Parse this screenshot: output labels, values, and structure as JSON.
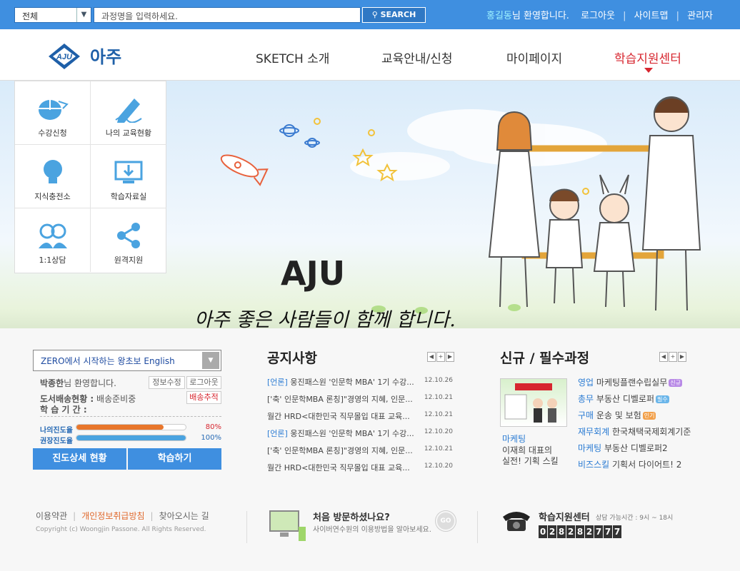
{
  "topbar": {
    "select_value": "전체",
    "search_placeholder": "과정명을 입력하세요.",
    "search_button": "SEARCH",
    "user_name": "홍길동",
    "welcome": "님 환영합니다.",
    "logout": "로그아웃",
    "sitemap": "사이트맵",
    "admin": "관리자"
  },
  "header": {
    "logo_mark": "AJU",
    "logo_text": "아주",
    "nav": [
      "SKETCH 소개",
      "교육안내/신청",
      "마이페이지",
      "학습지원센터"
    ],
    "active_nav": "학습지원센터"
  },
  "quick_menu": [
    {
      "label": "수강신청",
      "icon": "mouse-icon"
    },
    {
      "label": "나의 교육현황",
      "icon": "pencil-icon"
    },
    {
      "label": "지식충전소",
      "icon": "lightbulb-icon"
    },
    {
      "label": "학습자료실",
      "icon": "monitor-download-icon"
    },
    {
      "label": "1:1상담",
      "icon": "people-icon"
    },
    {
      "label": "원격지원",
      "icon": "share-icon"
    }
  ],
  "hero": {
    "title": "AJU",
    "slogan": "아주 좋은 사람들이 함께 합니다."
  },
  "learning": {
    "select_value": "ZERO에서 시작하는 왕초보 English",
    "user_name": "박종한",
    "welcome": "님 환영합니다.",
    "edit_info": "정보수정",
    "logout": "로그아웃",
    "delivery_label": "도서배송현황 :",
    "delivery_value": "배송준비중",
    "track_button": "배송추적",
    "period_label": "학 습 기 간 :",
    "period_value": "",
    "my_progress_label": "나의진도율",
    "my_progress": 80,
    "my_progress_text": "80%",
    "rec_progress_label": "권장진도율",
    "rec_progress": 100,
    "rec_progress_text": "100%",
    "detail_button": "진도상세 현황",
    "study_button": "학습하기",
    "colors": {
      "my": "#e8762b",
      "rec": "#4aa3e0"
    }
  },
  "notice": {
    "title": "공지사항",
    "items": [
      {
        "cat": "[언론]",
        "text": " 웅진패스원 '인문학 MBA' 1기 수강...",
        "date": "12.10.26"
      },
      {
        "cat": "",
        "text": "['축' 인문학MBA 론칭]\"경영의 지혜, 인문...",
        "date": "12.10.21"
      },
      {
        "cat": "",
        "text": "월간 HRD<대한민국 직무몰입 대표 교육...",
        "date": "12.10.21"
      },
      {
        "cat": "[언론]",
        "text": " 웅진패스원 '인문학 MBA' 1기 수강...",
        "date": "12.10.20"
      },
      {
        "cat": "",
        "text": "['축' 인문학MBA 론칭]\"경영의 지혜, 인문...",
        "date": "12.10.21"
      },
      {
        "cat": "",
        "text": "월간 HRD<대한민국 직무몰입 대표 교육...",
        "date": "12.10.20"
      }
    ]
  },
  "courses": {
    "title": "신규 / 필수과정",
    "feature_cat": "마케팅",
    "feature_text_1": "이재희 대표의",
    "feature_text_2": "실전! 기획 스킬",
    "items": [
      {
        "cat": "영업",
        "text": " 마케팅플랜수립실무",
        "badge": "신규"
      },
      {
        "cat": "총무",
        "text": " 부동산 디벨로퍼",
        "badge": "필수"
      },
      {
        "cat": "구매",
        "text": " 운송 및 보험",
        "badge": "인기"
      },
      {
        "cat": "재무회계",
        "text": " 한국채택국제회계기준",
        "badge": ""
      },
      {
        "cat": "마케팅",
        "text": " 부동산 디벨로퍼2",
        "badge": ""
      },
      {
        "cat": "비즈스킬",
        "text": " 기획서 다이어트! 2",
        "badge": ""
      }
    ]
  },
  "footer": {
    "terms": "이용약관",
    "privacy": "개인정보취급방침",
    "directions": "찾아오시는 길",
    "copyright": "Copyright (c) Woongjin Passone. All Rights Reserved.",
    "first_visit_title": "처음 방문하셨나요?",
    "first_visit_sub": "사이버연수원의 이용방법을 알아보세요.",
    "go": "GO",
    "support_title": "학습지원센터",
    "support_hours": "상담 가능시간 : 9시 ~ 18시",
    "phone_digits": [
      "0",
      "2",
      "8",
      "2",
      "8",
      "2",
      "7",
      "7",
      "7"
    ]
  }
}
